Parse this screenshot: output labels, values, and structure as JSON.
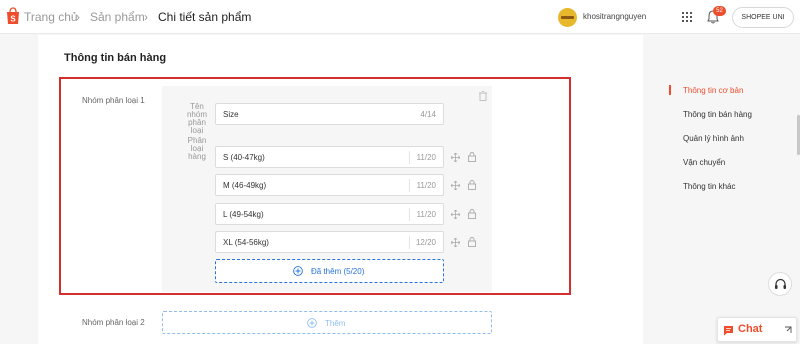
{
  "header": {
    "breadcrumb": [
      "Trang chủ",
      "Sản phẩm",
      "Chi tiết sản phẩm"
    ],
    "username": "khositrangnguyen",
    "notification_count": "52",
    "shopee_uni_label": "SHOPEE UNI"
  },
  "main": {
    "section_title": "Thông tin bán hàng",
    "group1": {
      "label": "Nhóm phân loại 1",
      "name_field_label": "Tên nhóm phân loại",
      "name_value": "Size",
      "name_count": "4/14",
      "options_label": "Phân loại hàng",
      "options": [
        {
          "value": "S (40-47kg)",
          "count": "11/20"
        },
        {
          "value": "M (46-49kg)",
          "count": "11/20"
        },
        {
          "value": "L (49-54kg)",
          "count": "11/20"
        },
        {
          "value": "XL (54-56kg)",
          "count": "12/20"
        }
      ],
      "add_button_label": "Đã thêm (5/20)"
    },
    "group2": {
      "label": "Nhóm phân loại 2",
      "add_button_label": "Thêm"
    }
  },
  "side_nav": {
    "items": [
      {
        "label": "Thông tin cơ bản",
        "active": true
      },
      {
        "label": "Thông tin bán hàng",
        "active": false
      },
      {
        "label": "Quản lý hình ảnh",
        "active": false
      },
      {
        "label": "Vận chuyển",
        "active": false
      },
      {
        "label": "Thông tin khác",
        "active": false
      }
    ]
  },
  "chat": {
    "label": "Chat"
  },
  "colors": {
    "brand": "#ee4d2d",
    "highlight_box": "#d32f2f",
    "link_blue": "#2673dd"
  }
}
